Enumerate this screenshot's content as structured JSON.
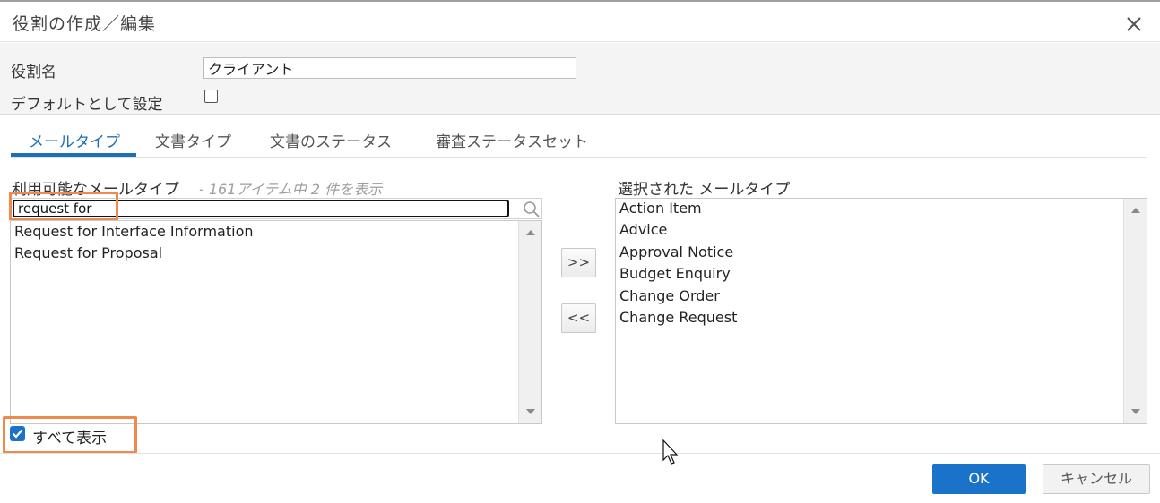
{
  "dialog": {
    "title": "役割の作成／編集"
  },
  "form": {
    "role_name_label": "役割名",
    "role_name_value": "クライアント",
    "default_label": "デフォルトとして設定",
    "default_checked": false
  },
  "tabs": [
    {
      "label": "メールタイプ",
      "active": true
    },
    {
      "label": "文書タイプ",
      "active": false
    },
    {
      "label": "文書のステータス",
      "active": false
    },
    {
      "label": "審査ステータスセット",
      "active": false
    }
  ],
  "available": {
    "label": "利用可能なメールタイプ",
    "count_text": "- 161アイテム中 2 件を表示",
    "search_value": "request for",
    "items": [
      "Request for Interface Information",
      "Request for Proposal"
    ]
  },
  "selected": {
    "label": "選択された メールタイプ",
    "items": [
      "Action Item",
      "Advice",
      "Approval Notice",
      "Budget Enquiry",
      "Change Order",
      "Change Request"
    ]
  },
  "buttons": {
    "add": ">>",
    "remove": "<<",
    "ok": "OK",
    "cancel": "キャンセル"
  },
  "show_all": {
    "label": "すべて表示",
    "checked": true
  },
  "colors": {
    "accent": "#1a73c8",
    "highlight": "#ef8a4c",
    "tab_active": "#1d6fb8"
  }
}
